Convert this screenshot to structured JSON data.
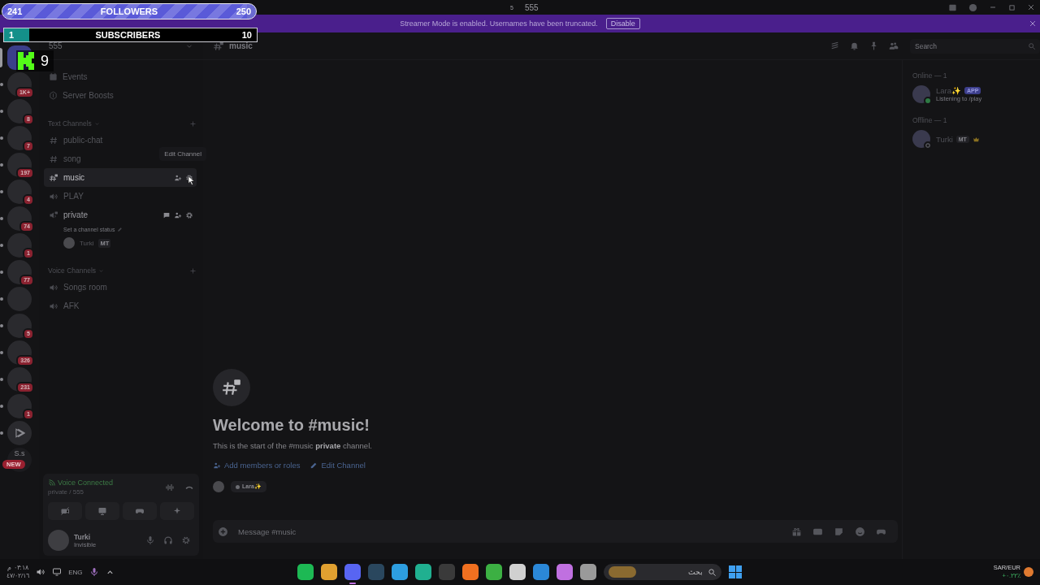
{
  "overlay": {
    "followers": {
      "current": "241",
      "label": "FOLLOWERS",
      "goal": "250",
      "level": 0.964
    },
    "subscribers": {
      "current": "1",
      "label": "SUBSCRIBERS",
      "goal": "10",
      "level": 0.1
    },
    "kick_count": "9"
  },
  "titlebar": {
    "badge": "5",
    "title": "555"
  },
  "banner": {
    "text": "Streamer Mode is enabled. Usernames have been truncated.",
    "button": "Disable"
  },
  "servers": [
    {
      "kind": "server",
      "selected": true,
      "unread": false
    },
    {
      "kind": "server",
      "selected": false,
      "unread": true,
      "badge": "1K+"
    },
    {
      "kind": "server",
      "selected": false,
      "unread": true,
      "badge": "8"
    },
    {
      "kind": "server",
      "selected": false,
      "unread": true,
      "badge": "7"
    },
    {
      "kind": "server",
      "selected": false,
      "unread": true,
      "badge": "197"
    },
    {
      "kind": "server",
      "selected": false,
      "unread": true,
      "badge": "4"
    },
    {
      "kind": "server",
      "selected": false,
      "unread": true,
      "badge": "74"
    },
    {
      "kind": "server",
      "selected": false,
      "unread": true,
      "badge": "1"
    },
    {
      "kind": "server",
      "selected": false,
      "unread": true,
      "badge": "77"
    },
    {
      "kind": "server",
      "selected": false,
      "unread": true
    },
    {
      "kind": "server",
      "selected": false,
      "unread": true,
      "badge": "5"
    },
    {
      "kind": "server",
      "selected": false,
      "unread": true,
      "badge": "326"
    },
    {
      "kind": "server",
      "selected": false,
      "unread": true,
      "badge": "231"
    },
    {
      "kind": "server",
      "selected": false,
      "unread": true,
      "badge": "1"
    },
    {
      "kind": "play",
      "selected": false,
      "unread": true
    },
    {
      "kind": "initials",
      "selected": false,
      "unread": false,
      "initials": "S.s",
      "tag": "NEW"
    }
  ],
  "sidebar": {
    "server_name": "555",
    "items": [
      {
        "kind": "events",
        "label": "Events"
      },
      {
        "kind": "boosts",
        "label": "Server Boosts"
      }
    ],
    "categories": [
      {
        "name": "Text Channels",
        "channels": [
          {
            "kind": "text",
            "name": "public-chat",
            "selected": false
          },
          {
            "kind": "text",
            "name": "song",
            "selected": false
          },
          {
            "kind": "text-locked",
            "name": "music",
            "selected": true,
            "tooltip": "Edit Channel"
          },
          {
            "kind": "voice",
            "name": "PLAY",
            "selected": false
          },
          {
            "kind": "voice-locked",
            "name": "private",
            "selected": false,
            "connected": true,
            "status_prompt": "Set a channel status",
            "members": [
              {
                "name": "Turki",
                "tag": "MT"
              }
            ]
          }
        ]
      },
      {
        "name": "Voice Channels",
        "channels": [
          {
            "kind": "voice",
            "name": "Songs room",
            "selected": false
          },
          {
            "kind": "voice",
            "name": "AFK",
            "selected": false
          }
        ]
      }
    ],
    "voice": {
      "status": "Voice Connected",
      "location": "private / 555"
    },
    "user": {
      "name": "Turki",
      "status": "Invisible"
    }
  },
  "header": {
    "channel": "music",
    "search_placeholder": "Search"
  },
  "welcome": {
    "title": "Welcome to #music!",
    "text": "This is the start of the #music **private** channel.",
    "actions": [
      "Add members or roles",
      "Edit Channel"
    ],
    "chip": "Lara✨"
  },
  "composer": {
    "placeholder": "Message #music"
  },
  "members": [
    {
      "title": "Online — 1",
      "members": [
        {
          "name": "Lara✨",
          "tag": "APP",
          "activity": "Listening to /play",
          "online": true
        }
      ]
    },
    {
      "title": "Offline — 1",
      "members": [
        {
          "name": "Turki",
          "tag": "MT",
          "online": false,
          "owner": true
        }
      ]
    }
  ],
  "taskbar": {
    "time": "٠٣:١٨ م",
    "date": "٤٧/٠٢/١٦",
    "language": "ENG",
    "apps": [
      {
        "color": "#1db954"
      },
      {
        "color": "#e0a030"
      },
      {
        "color": "#5865f2",
        "active": true
      },
      {
        "color": "#2a475e"
      },
      {
        "color": "#2d9ee0"
      },
      {
        "color": "#20b090"
      },
      {
        "color": "#3a3a3a"
      },
      {
        "color": "#f07020"
      },
      {
        "color": "#3cb043"
      },
      {
        "color": "#d0d0d0"
      },
      {
        "color": "#2b88d8"
      },
      {
        "color": "#c070e0"
      },
      {
        "color": "#9a9a9a"
      }
    ],
    "search": "بحث",
    "currency": "SAR/EUR",
    "change": "+٠.٢٢٪"
  }
}
